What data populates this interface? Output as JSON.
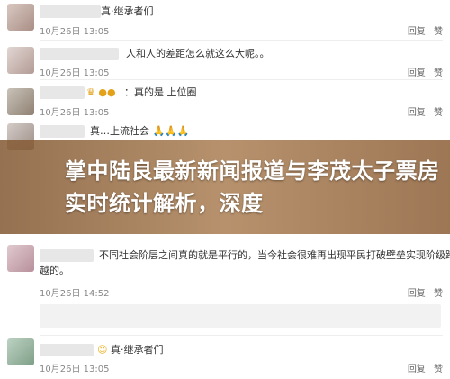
{
  "comments": [
    {
      "name": "",
      "name_suffix": "真·继承者们",
      "text": "",
      "time": "10月26日 13:05",
      "reply": "回复",
      "like": "赞"
    },
    {
      "name": "",
      "text": "人和人的差距怎么就这么大呢。。",
      "time": "10月26日 13:05",
      "reply": "回复",
      "like": "赞"
    },
    {
      "name": "",
      "prefix": "：真的是 上位圈",
      "time": "10月26日 13:05",
      "reply": "回复",
      "like": "赞"
    },
    {
      "name": "",
      "prefix": "真…上流社会",
      "time": "",
      "reply": "",
      "like": ""
    },
    {
      "name": "",
      "text": "",
      "time": "",
      "reply": "",
      "like": ""
    },
    {
      "name": "",
      "text_line1": "不同社会阶层之间真的就是平行的，当今社会很难再出现平民打破壁垒实现阶级跨",
      "text_line2": "越的。",
      "time": "10月26日 14:52",
      "reply": "回复",
      "like": "赞"
    },
    {
      "name": "",
      "text": "真·继承者们",
      "time": "10月26日 13:05",
      "reply": "回复",
      "like": "赞"
    }
  ],
  "banner": {
    "title": "掌中陆良最新新闻报道与李茂太子票房实时统计解析，深度"
  },
  "icons": {
    "medal": "medal-icon",
    "emoji_praise": "praise-hands-emoji"
  }
}
